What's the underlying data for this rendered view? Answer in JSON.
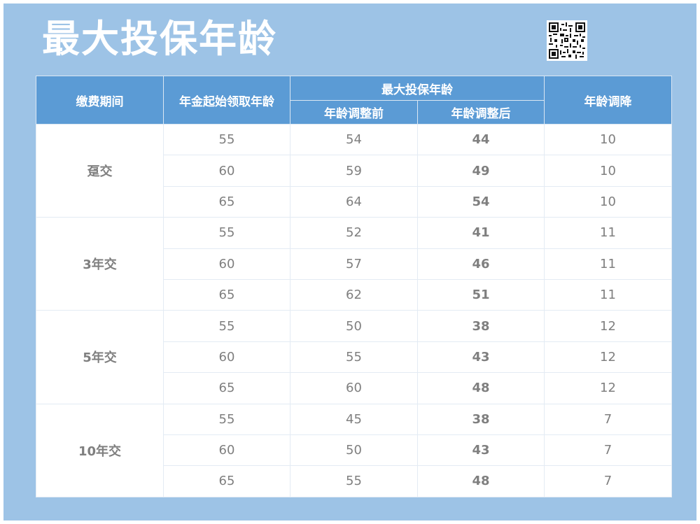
{
  "title": "最大投保年龄",
  "headers": {
    "period": "缴费期间",
    "start_age": "年金起始领取年龄",
    "max_age": "最大投保年龄",
    "before": "年龄调整前",
    "after": "年龄调整后",
    "reduce": "年龄调降"
  },
  "groups": [
    {
      "period": "趸交",
      "rows": [
        {
          "start": "55",
          "before": "54",
          "after": "44",
          "reduce": "10"
        },
        {
          "start": "60",
          "before": "59",
          "after": "49",
          "reduce": "10"
        },
        {
          "start": "65",
          "before": "64",
          "after": "54",
          "reduce": "10"
        }
      ]
    },
    {
      "period": "3年交",
      "rows": [
        {
          "start": "55",
          "before": "52",
          "after": "41",
          "reduce": "11"
        },
        {
          "start": "60",
          "before": "57",
          "after": "46",
          "reduce": "11"
        },
        {
          "start": "65",
          "before": "62",
          "after": "51",
          "reduce": "11"
        }
      ]
    },
    {
      "period": "5年交",
      "rows": [
        {
          "start": "55",
          "before": "50",
          "after": "38",
          "reduce": "12"
        },
        {
          "start": "60",
          "before": "55",
          "after": "43",
          "reduce": "12"
        },
        {
          "start": "65",
          "before": "60",
          "after": "48",
          "reduce": "12"
        }
      ]
    },
    {
      "period": "10年交",
      "rows": [
        {
          "start": "55",
          "before": "45",
          "after": "38",
          "reduce": "7"
        },
        {
          "start": "60",
          "before": "50",
          "after": "43",
          "reduce": "7"
        },
        {
          "start": "65",
          "before": "55",
          "after": "48",
          "reduce": "7"
        }
      ]
    }
  ],
  "colors": {
    "background": "#9dc3e6",
    "header": "#5b9bd5",
    "highlight": "#e8000b",
    "value": "#7f7f7f"
  },
  "icons": {
    "qr": "qr-code-icon"
  }
}
